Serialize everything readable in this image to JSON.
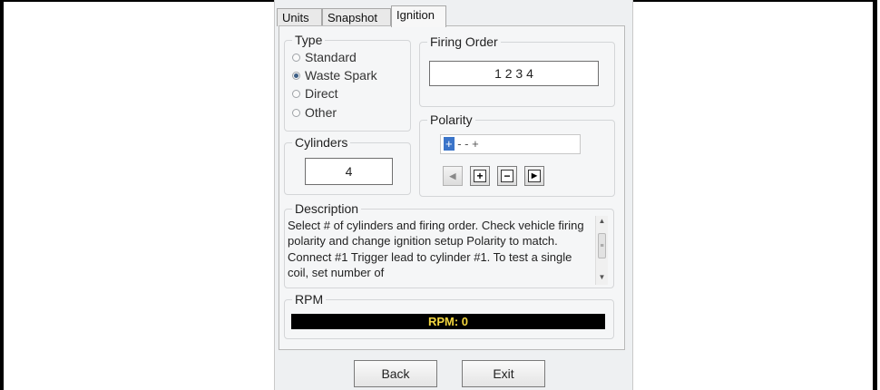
{
  "tabs": [
    "Units",
    "Snapshot",
    "Ignition"
  ],
  "active_tab": "Ignition",
  "type_group": {
    "title": "Type",
    "options": [
      {
        "label": "Standard",
        "selected": false
      },
      {
        "label": "Waste Spark",
        "selected": true
      },
      {
        "label": "Direct",
        "selected": false
      },
      {
        "label": "Other",
        "selected": false
      }
    ]
  },
  "firing_order": {
    "title": "Firing Order",
    "value": "1 2 3 4"
  },
  "cylinders": {
    "title": "Cylinders",
    "value": "4"
  },
  "polarity": {
    "title": "Polarity",
    "selected_symbol": "+",
    "rest": " - - +",
    "buttons": [
      {
        "name": "prev",
        "icon": "left-arrow-icon",
        "glyph": "◀",
        "enabled": false
      },
      {
        "name": "plus",
        "icon": "plus-icon",
        "glyph": "+",
        "enabled": true
      },
      {
        "name": "minus",
        "icon": "minus-icon",
        "glyph": "−",
        "enabled": true
      },
      {
        "name": "next",
        "icon": "right-arrow-icon",
        "glyph": "▶",
        "enabled": true
      }
    ]
  },
  "description": {
    "title": "Description",
    "text": "Select # of cylinders and firing order. Check vehicle firing polarity and change ignition setup Polarity to match. Connect #1 Trigger lead to cylinder #1. To test a single coil, set number of"
  },
  "rpm": {
    "title": "RPM",
    "value": "RPM: 0",
    "color": "#f3d63f"
  },
  "footer": {
    "back_label": "Back",
    "exit_label": "Exit"
  }
}
